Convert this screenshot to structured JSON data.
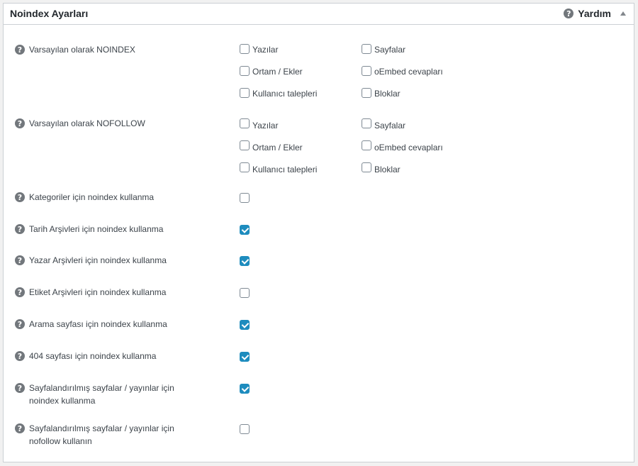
{
  "panel": {
    "title": "Noindex Ayarları",
    "help_label": "Yardım",
    "help_icon": "question-circle-icon",
    "toggle_icon": "caret-up-icon"
  },
  "noindex_default": {
    "label": "Varsayılan olarak NOINDEX",
    "options": [
      {
        "label": "Yazılar",
        "checked": false
      },
      {
        "label": "Sayfalar",
        "checked": false
      },
      {
        "label": "Ortam / Ekler",
        "checked": false
      },
      {
        "label": "oEmbed cevapları",
        "checked": false
      },
      {
        "label": "Kullanıcı talepleri",
        "checked": false
      },
      {
        "label": "Bloklar",
        "checked": false
      }
    ]
  },
  "nofollow_default": {
    "label": "Varsayılan olarak NOFOLLOW",
    "options": [
      {
        "label": "Yazılar",
        "checked": false
      },
      {
        "label": "Sayfalar",
        "checked": false
      },
      {
        "label": "Ortam / Ekler",
        "checked": false
      },
      {
        "label": "oEmbed cevapları",
        "checked": false
      },
      {
        "label": "Kullanıcı talepleri",
        "checked": false
      },
      {
        "label": "Bloklar",
        "checked": false
      }
    ]
  },
  "settings": [
    {
      "label": "Kategoriler için noindex kullanma",
      "checked": false
    },
    {
      "label": "Tarih Arşivleri için noindex kullanma",
      "checked": true
    },
    {
      "label": "Yazar Arşivleri için noindex kullanma",
      "checked": true
    },
    {
      "label": "Etiket Arşivleri için noindex kullanma",
      "checked": false
    },
    {
      "label": "Arama sayfası için noindex kullanma",
      "checked": true
    },
    {
      "label": "404 sayfası için noindex kullanma",
      "checked": true
    },
    {
      "label": "Sayfalandırılmış sayfalar / yayınlar için noindex kullanma",
      "checked": true
    },
    {
      "label": "Sayfalandırılmış sayfalar / yayınlar için nofollow kullanın",
      "checked": false
    }
  ],
  "colors": {
    "accent": "#1e8cbe",
    "border": "#ccd0d4",
    "help_icon": "#72777c"
  }
}
